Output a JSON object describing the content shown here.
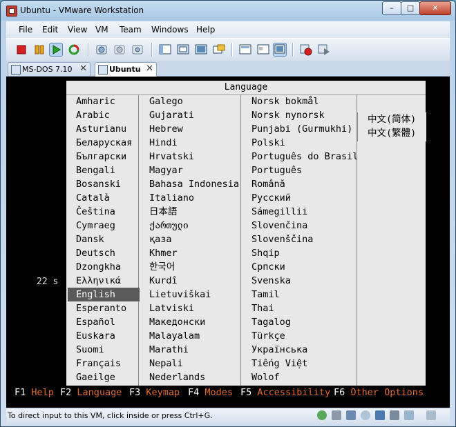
{
  "window": {
    "title": "Ubuntu - VMware Workstation",
    "min": "–",
    "max": "□",
    "close": "✕"
  },
  "menu": [
    "File",
    "Edit",
    "View",
    "VM",
    "Team",
    "Windows",
    "Help"
  ],
  "toolbar": {
    "icons": [
      "stop-icon",
      "pause-icon",
      "play-icon",
      "reset-icon",
      "snapshot-icon",
      "revert-snapshot-icon",
      "snapshot-manager-icon",
      "normal-view-icon",
      "fullscreen-icon",
      "quick-switch-icon",
      "summary-view-icon",
      "console-view-icon",
      "appliance-view-icon",
      "record-icon",
      "replay-icon"
    ]
  },
  "tabs": [
    {
      "label": "MS-DOS 7.10",
      "close": "✕",
      "active": false
    },
    {
      "label": "Ubuntu",
      "close": "✕",
      "active": true
    }
  ],
  "boot": {
    "panel_title": "Language",
    "timer": "22 s",
    "columns": [
      [
        "Amharic",
        "Arabic",
        "Asturianu",
        "Беларуская",
        "Български",
        "Bengali",
        "Bosanski",
        "Català",
        "Čeština",
        "Cymraeg",
        "Dansk",
        "Deutsch",
        "Dzongkha",
        "Ελληνικά",
        "English",
        "Esperanto",
        "Español",
        "Euskara",
        "Suomi",
        "Français",
        "Gaeilge"
      ],
      [
        "Galego",
        "Gujarati",
        "Hebrew",
        "Hindi",
        "Hrvatski",
        "Magyar",
        "Bahasa Indonesia",
        "Italiano",
        "日本語",
        "ქართული",
        "қаза",
        "Khmer",
        "한국어",
        "Kurdî",
        "Lietuviškai",
        "Latviski",
        "Македонски",
        "Malayalam",
        "Marathi",
        "Nepali",
        "Nederlands"
      ],
      [
        "Norsk bokmål",
        "Norsk nynorsk",
        "Punjabi (Gurmukhi)",
        "Polski",
        "Português do Brasil",
        "Português",
        "Română",
        "Русский",
        "Sámegillii",
        "Slovenčina",
        "Slovenščina",
        "Shqip",
        "Српски",
        "Svenska",
        "Tamil",
        "Thai",
        "Tagalog",
        "Türkçe",
        "Українська",
        "Tiếng Việt",
        "Wolof"
      ],
      [
        "中文(简体)",
        "中文(繁體)"
      ]
    ],
    "selected": "English",
    "fkeys": [
      {
        "key": "F1",
        "label": "Help"
      },
      {
        "key": "F2",
        "label": "Language"
      },
      {
        "key": "F3",
        "label": "Keymap"
      },
      {
        "key": "F4",
        "label": "Modes"
      },
      {
        "key": "F5",
        "label": "Accessibility"
      },
      {
        "key": "F6",
        "label": "Other Options"
      }
    ]
  },
  "status": {
    "text": "To direct input to this VM, click inside or press Ctrl+G.",
    "icons": [
      "network-icon",
      "hard-disk-icon",
      "floppy-icon",
      "cd-icon",
      "usb-icon",
      "sound-icon",
      "display-icon",
      "message-icon"
    ]
  },
  "colors": {
    "accent_orange": "#e06a2a",
    "highlight": "#5a5a5a",
    "panel": "#e8e8e8"
  }
}
